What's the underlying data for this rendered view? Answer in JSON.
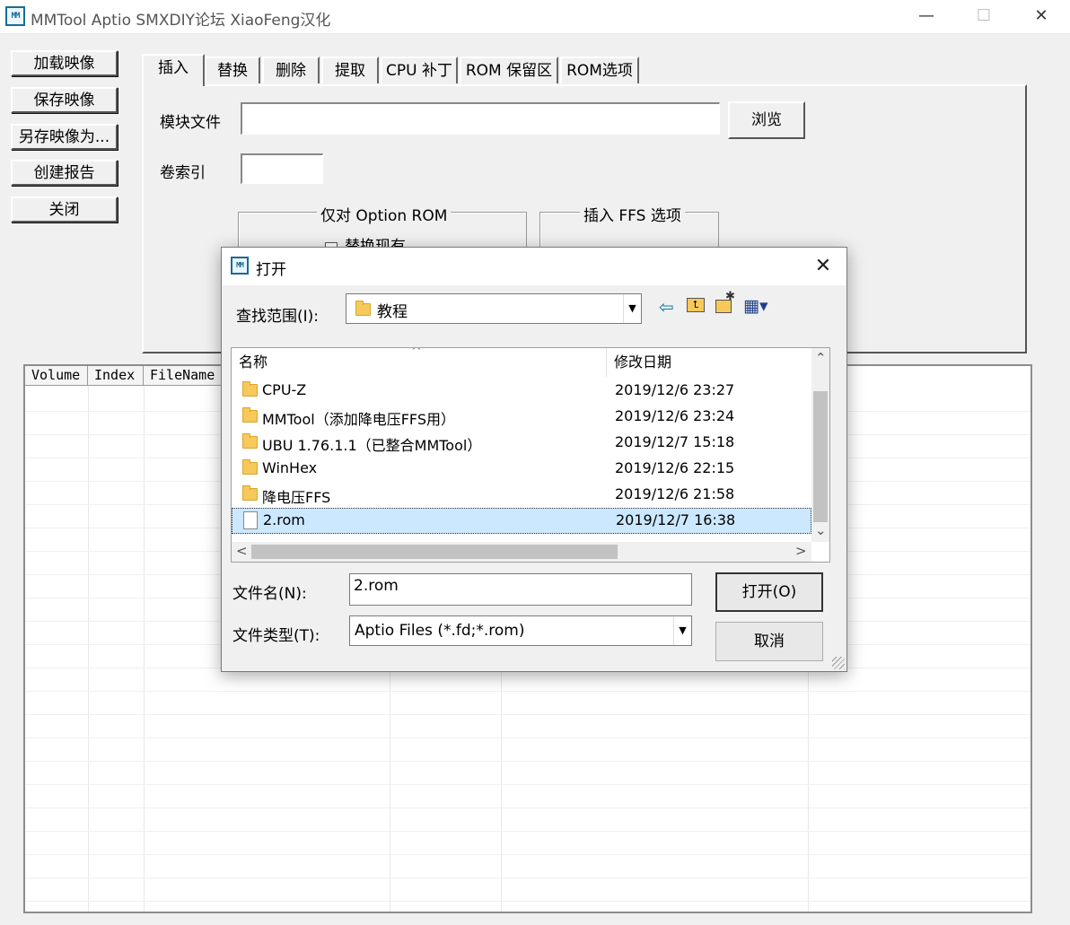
{
  "window": {
    "icon_text": "MM",
    "title": "MMTool Aptio SMXDIY论坛 XiaoFeng汉化",
    "controls": {
      "minimize": "—",
      "maximize": "☐",
      "close": "✕"
    }
  },
  "command_buttons": [
    "加载映像",
    "保存映像",
    "另存映像为...",
    "创建报告",
    "关闭"
  ],
  "tabs": [
    "插入",
    "替换",
    "删除",
    "提取",
    "CPU 补丁",
    "ROM 保留区",
    "ROM选项"
  ],
  "insert_panel": {
    "module_file_label": "模块文件",
    "module_file_value": "",
    "browse_label": "浏览",
    "volume_index_label": "卷索引",
    "volume_index_value": "",
    "option_rom_group": "仅对 Option ROM",
    "option_rom_checkbox_partial": "替换现有",
    "ffs_group": "插入 FFS 选项"
  },
  "volume_table": {
    "columns": [
      "Volume",
      "Index",
      "FileName"
    ]
  },
  "dialog": {
    "icon_text": "MM",
    "title": "打开",
    "close": "✕",
    "look_in_label": "查找范围(I):",
    "look_in_value": "教程",
    "toolbar_glyphs": {
      "back": "⇦",
      "up": "⮤",
      "new_folder": "✱",
      "view": "▦▾"
    },
    "columns": {
      "name": "名称",
      "date": "修改日期",
      "sort_glyph": "^"
    },
    "files": [
      {
        "name": "CPU-Z",
        "date": "2019/12/6 23:27",
        "type": "folder"
      },
      {
        "name": "MMTool（添加降电压FFS用）",
        "date": "2019/12/6 23:24",
        "type": "folder"
      },
      {
        "name": "UBU 1.76.1.1（已整合MMTool）",
        "date": "2019/12/7 15:18",
        "type": "folder"
      },
      {
        "name": "WinHex",
        "date": "2019/12/6 22:15",
        "type": "folder"
      },
      {
        "name": "降电压FFS",
        "date": "2019/12/6 21:58",
        "type": "folder"
      },
      {
        "name": "2.rom",
        "date": "2019/12/7 16:38",
        "type": "file",
        "selected": true
      }
    ],
    "filename_label": "文件名(N):",
    "filename_value": "2.rom",
    "filetype_label": "文件类型(T):",
    "filetype_value": "Aptio Files (*.fd;*.rom)",
    "open_button": "打开(O)",
    "cancel_button": "取消",
    "scroll_glyphs": {
      "up": "⌃",
      "down": "⌄",
      "left": "<",
      "right": ">"
    }
  }
}
